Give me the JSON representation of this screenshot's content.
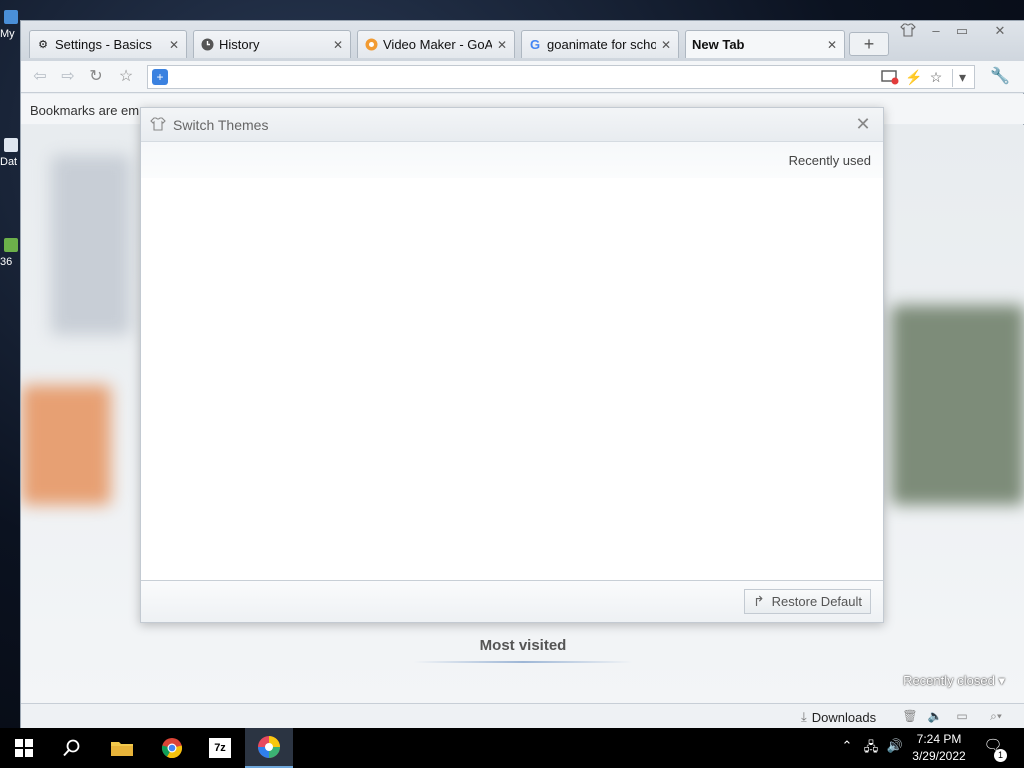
{
  "desktop": {
    "icons": [
      {
        "label": "My"
      },
      {
        "label": "Dat"
      },
      {
        "label": "36"
      }
    ]
  },
  "browser": {
    "tabs": [
      {
        "label": "Settings - Basics",
        "icon": "gear-icon",
        "active": false
      },
      {
        "label": "History",
        "icon": "clock-icon",
        "active": false
      },
      {
        "label": "Video Maker - GoAnimate",
        "icon": "goanimate-icon",
        "active": false
      },
      {
        "label": "goanimate for school",
        "icon": "google-icon",
        "active": false
      },
      {
        "label": "New Tab",
        "icon": "",
        "active": true
      }
    ],
    "new_tab_label": "+",
    "bookmarks_bar_text": "Bookmarks are em",
    "most_visited": "Most visited",
    "recently_closed": "Recently closed",
    "downloads_label": "Downloads"
  },
  "dialog": {
    "title": "Switch Themes",
    "recently_used": "Recently used",
    "restore_label": "Restore Default"
  },
  "taskbar": {
    "time": "7:24 PM",
    "date": "3/29/2022",
    "notification_count": "1",
    "apps": [
      "start",
      "search",
      "file-explorer",
      "chrome",
      "7-zip",
      "browser-360"
    ]
  }
}
